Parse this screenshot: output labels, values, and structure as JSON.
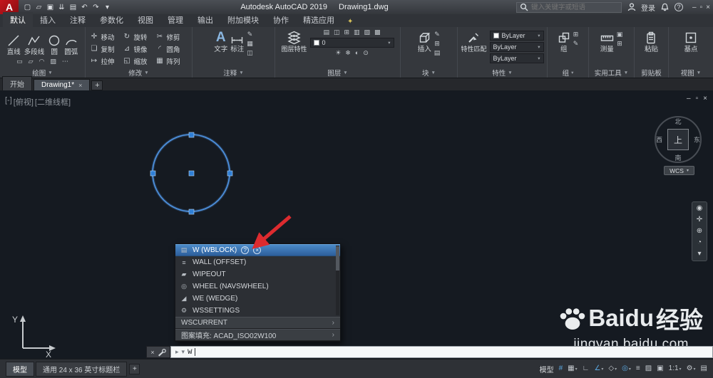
{
  "ui": {
    "caret": "▾",
    "panel_caret": "▼"
  },
  "titlebar": {
    "logo": "A",
    "qat": [
      {
        "name": "new-file-icon",
        "glyph": "▢"
      },
      {
        "name": "open-file-icon",
        "glyph": "▱"
      },
      {
        "name": "save-icon",
        "glyph": "▣"
      },
      {
        "name": "save-as-icon",
        "glyph": "⇊"
      },
      {
        "name": "plot-icon",
        "glyph": "▤"
      },
      {
        "name": "undo-icon",
        "glyph": "↶"
      },
      {
        "name": "redo-icon",
        "glyph": "↷"
      },
      {
        "name": "qat-dropdown-icon",
        "glyph": "▾"
      }
    ],
    "app_title": "Autodesk AutoCAD 2019",
    "doc_title": "Drawing1.dwg",
    "search_placeholder": "键入关键字或短语",
    "signin": "登录",
    "help": "?",
    "window_buttons": [
      {
        "name": "minimize-button",
        "glyph": "–"
      },
      {
        "name": "restore-button",
        "glyph": "▫"
      },
      {
        "name": "close-button",
        "glyph": "×"
      }
    ]
  },
  "ribbon": {
    "tabs": [
      {
        "label": "默认",
        "active": true
      },
      {
        "label": "插入"
      },
      {
        "label": "注释"
      },
      {
        "label": "参数化"
      },
      {
        "label": "视图"
      },
      {
        "label": "管理"
      },
      {
        "label": "输出"
      },
      {
        "label": "附加模块"
      },
      {
        "label": "协作"
      },
      {
        "label": "精选应用"
      }
    ],
    "bulb": "✦",
    "panels": {
      "draw": {
        "name": "绘图",
        "caret": "▼",
        "tool_line": "直线",
        "tool_polyline": "多段线",
        "tool_circle": "圆",
        "tool_arc": "圆弧",
        "minis": [
          "▭",
          "▱",
          "◠",
          "▨",
          "⋯"
        ]
      },
      "modify": {
        "name": "修改",
        "caret": "▼",
        "tools": [
          {
            "glyph": "✛",
            "label": "移动"
          },
          {
            "glyph": "↻",
            "label": "旋转"
          },
          {
            "glyph": "✂",
            "label": "修剪"
          },
          {
            "glyph": "❏",
            "label": "复制"
          },
          {
            "glyph": "⊿",
            "label": "镜像"
          },
          {
            "glyph": "◜",
            "label": "圆角"
          },
          {
            "glyph": "↦",
            "label": "拉伸"
          },
          {
            "glyph": "◱",
            "label": "缩放"
          },
          {
            "glyph": "▦",
            "label": "阵列"
          }
        ]
      },
      "annotate": {
        "name": "注释",
        "caret": "▼",
        "text_glyph": "A",
        "text_label": "文字",
        "dim_label": "标注",
        "minis": [
          "✎",
          "▦",
          "◫"
        ]
      },
      "layers": {
        "name": "图层",
        "caret": "▼",
        "big_label": "图层特性",
        "row1": [
          "▤",
          "◫",
          "⊞",
          "▥",
          "▧",
          "▩"
        ],
        "combo_value": "0",
        "row2": [
          "☀",
          "❄",
          "◐",
          "⊙"
        ]
      },
      "block": {
        "name": "块",
        "caret": "▼",
        "big_label": "插入",
        "minis": [
          "✎",
          "⊞",
          "▤"
        ]
      },
      "properties": {
        "name": "特性",
        "caret": "▼",
        "big_label": "特性匹配",
        "combos": [
          {
            "value": "ByLayer",
            "swatch": true
          },
          {
            "value": "ByLayer"
          },
          {
            "value": "ByLayer"
          }
        ]
      },
      "groups": {
        "name": "组",
        "caret": "▾",
        "big_label": "组",
        "minis": [
          "⊞",
          "✎"
        ]
      },
      "utilities": {
        "name": "实用工具",
        "caret": "▼",
        "big_label": "测量",
        "minis": [
          "▣",
          "⊞"
        ]
      },
      "clipboard": {
        "name": "剪贴板",
        "big_label": "粘贴"
      },
      "view": {
        "name": "视图",
        "caret": "▼",
        "big_label": "基点"
      }
    }
  },
  "file_tabs": {
    "tabs": [
      {
        "label": "开始"
      },
      {
        "label": "Drawing1*",
        "active": true,
        "close": "×"
      }
    ],
    "add": "+"
  },
  "viewport": {
    "controls": [
      "[-]",
      "[俯视]",
      "[二维线框]"
    ],
    "doc_buttons": [
      {
        "name": "doc-minimize-button",
        "glyph": "–"
      },
      {
        "name": "doc-restore-button",
        "glyph": "▫"
      },
      {
        "name": "doc-close-button",
        "glyph": "×"
      }
    ],
    "viewcube": {
      "north": "北",
      "south": "南",
      "east": "东",
      "west": "西",
      "top": "上",
      "wcs": "WCS"
    },
    "navbar": [
      {
        "name": "steering-wheel-icon",
        "glyph": "◉"
      },
      {
        "name": "pan-icon",
        "glyph": "✛"
      },
      {
        "name": "zoom-icon",
        "glyph": "⊕"
      },
      {
        "name": "orbit-icon",
        "glyph": "◔"
      },
      {
        "name": "navbar-more-icon",
        "glyph": "▾"
      }
    ],
    "ucs": {
      "x": "X",
      "y": "Y"
    }
  },
  "popup": {
    "items": [
      {
        "glyph": "▤",
        "label": "W (WBLOCK)",
        "selected": true,
        "badge1": "?",
        "badge2": "×"
      },
      {
        "glyph": "≡",
        "label": "WALL (OFFSET)"
      },
      {
        "glyph": "▰",
        "label": "WIPEOUT"
      },
      {
        "glyph": "◎",
        "label": "WHEEL (NAVSWHEEL)"
      },
      {
        "glyph": "◢",
        "label": "WE (WEDGE)"
      },
      {
        "glyph": "⚙",
        "label": "WSSETTINGS"
      }
    ],
    "sections": [
      {
        "label": "WSCURRENT",
        "arrow": "›"
      },
      {
        "label": "图案填充: ACAD_ISO02W100",
        "arrow": "›"
      }
    ]
  },
  "cmdline": {
    "close": "×",
    "prompt": "▸",
    "value": "W"
  },
  "watermark": {
    "brand": "Baidu",
    "brand_cn": "经验",
    "url": "jingyan.baidu.com"
  },
  "bottombar": {
    "layout_tabs": [
      {
        "label": "模型",
        "active": true
      },
      {
        "label": "通用 24 x 36 英寸标题栏"
      }
    ],
    "add_layout": "+",
    "model_label": "模型",
    "icons": [
      {
        "name": "grid-icon",
        "glyph": "#",
        "active": true
      },
      {
        "name": "snap-icon",
        "glyph": "▦",
        "caret": true
      },
      {
        "name": "ortho-icon",
        "glyph": "∟"
      },
      {
        "name": "polar-tracking-icon",
        "glyph": "∠",
        "caret": true,
        "active": true
      },
      {
        "name": "isodraft-icon",
        "glyph": "◇",
        "caret": true
      },
      {
        "name": "osnap-icon",
        "glyph": "◎",
        "caret": true,
        "active": true
      },
      {
        "name": "lineweight-icon",
        "glyph": "≡"
      },
      {
        "name": "transparency-icon",
        "glyph": "▨"
      },
      {
        "name": "selection-cycling-icon",
        "glyph": "▣"
      },
      {
        "name": "annotation-scale-toggle",
        "glyph": "1:1",
        "caret": true
      },
      {
        "name": "workspace-gear-icon",
        "glyph": "⚙",
        "caret": true
      },
      {
        "name": "customize-icon",
        "glyph": "▤"
      }
    ]
  },
  "colors": {
    "active_blue": "#5aa7e0",
    "selection_blue": "#3a76b8",
    "arrow_red": "#dc2b2f",
    "circle_blue": "#4f94e3"
  }
}
